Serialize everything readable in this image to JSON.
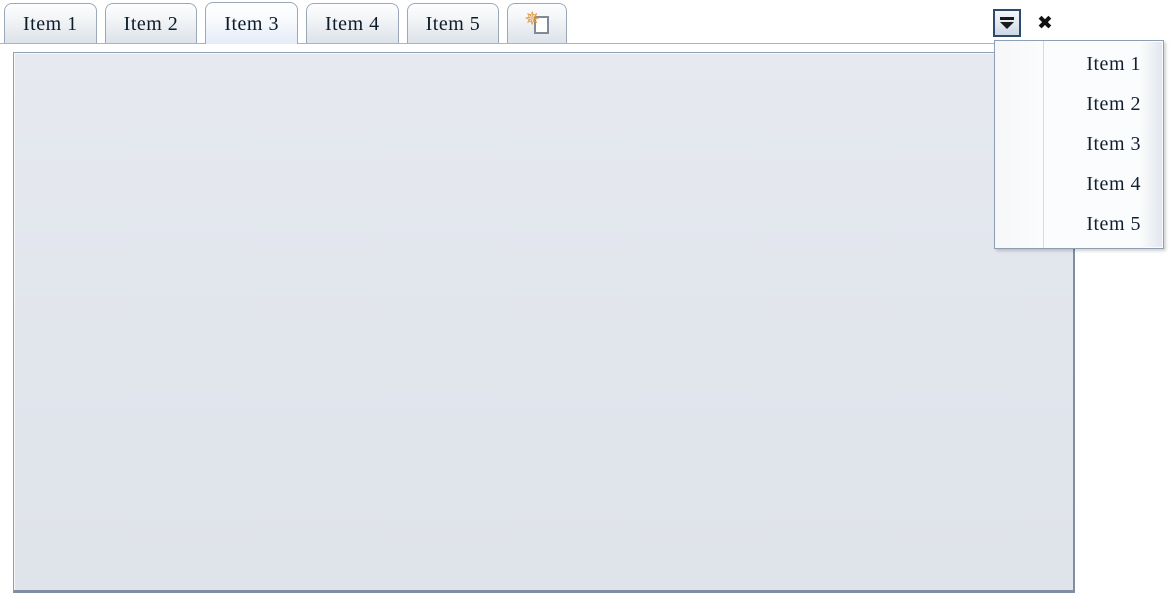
{
  "widget": {
    "name": "Tab Panel"
  },
  "tabs": [
    {
      "label": "Item 1",
      "selected": false
    },
    {
      "label": "Item 2",
      "selected": false
    },
    {
      "label": "Item 3",
      "selected": true
    },
    {
      "label": "Item 4",
      "selected": false
    },
    {
      "label": "Item 5",
      "selected": false
    }
  ],
  "new_tab_button": {
    "icon": "new-document-sparkle-icon",
    "label": ""
  },
  "controls": {
    "menu_button": {
      "icon": "list-dropdown-icon",
      "label": ""
    },
    "close_button": {
      "icon": "close-icon",
      "label": "✖"
    }
  },
  "dropdown_menu": {
    "open": true,
    "items": [
      {
        "label": "Item 1"
      },
      {
        "label": "Item 2"
      },
      {
        "label": "Item 3"
      },
      {
        "label": "Item 4"
      },
      {
        "label": "Item 5"
      }
    ]
  },
  "content_panel": {
    "text": ""
  },
  "colors": {
    "tab_border": "#9aa8ba",
    "tab_text": "#0d1b2a",
    "panel_fill": "#e1e5ec",
    "panel_border": "#8f9eb2",
    "menu_button_border": "#2d4a6b",
    "sparkle_orange": "#e29a3c",
    "menu_background": "#fbfcfd"
  }
}
